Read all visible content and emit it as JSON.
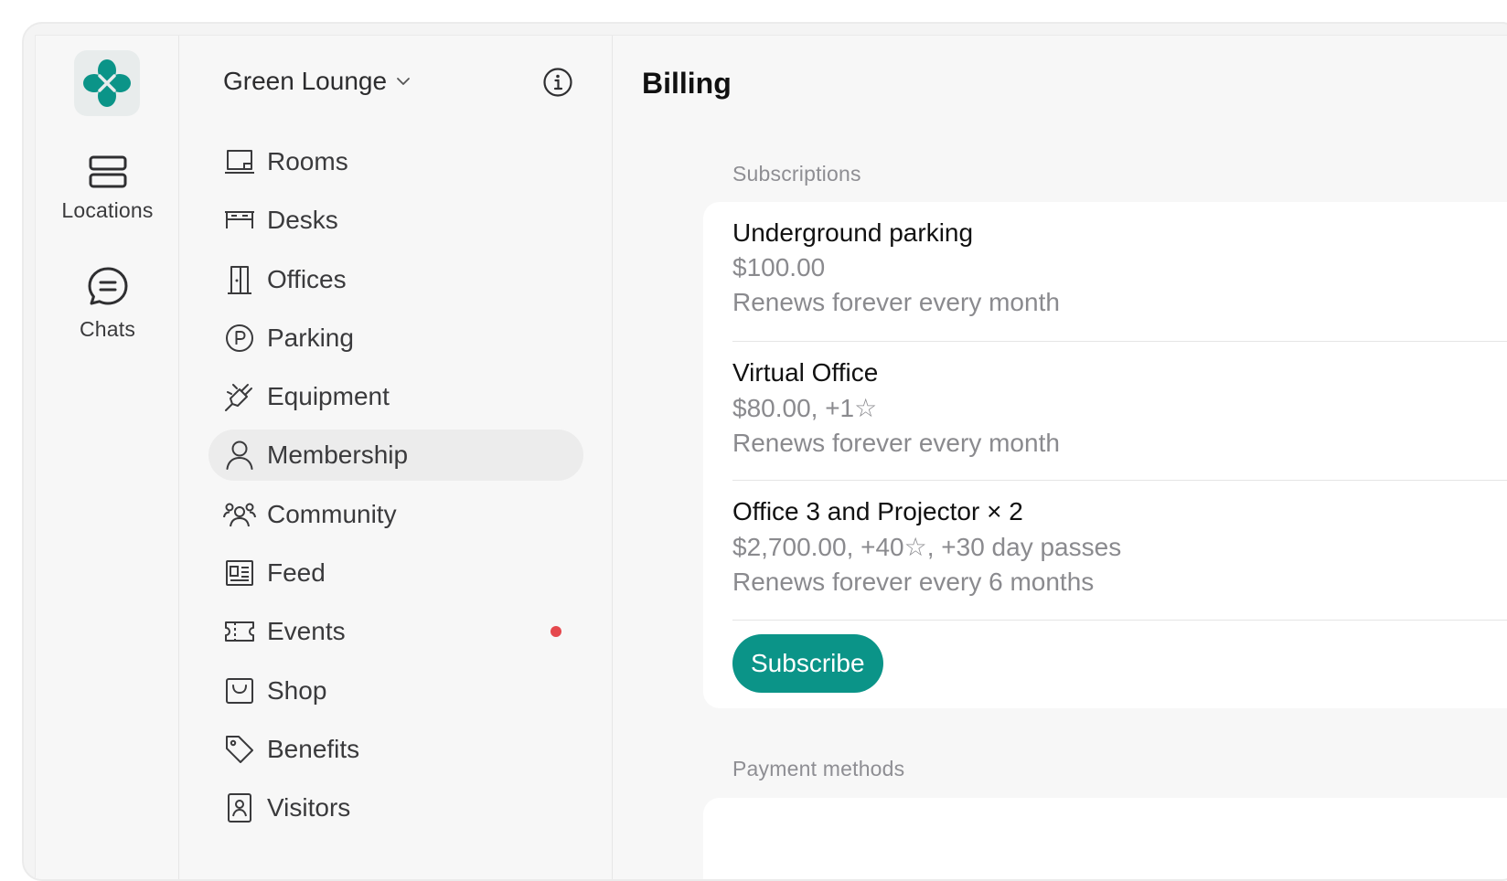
{
  "rail": {
    "items": [
      {
        "label": "Locations",
        "icon": "locations-icon"
      },
      {
        "label": "Chats",
        "icon": "chat-bubble-icon"
      }
    ]
  },
  "nav": {
    "location_name": "Green Lounge",
    "items": [
      {
        "label": "Rooms",
        "icon": "room-icon"
      },
      {
        "label": "Desks",
        "icon": "desk-icon"
      },
      {
        "label": "Offices",
        "icon": "door-icon"
      },
      {
        "label": "Parking",
        "icon": "parking-icon"
      },
      {
        "label": "Equipment",
        "icon": "plug-icon"
      },
      {
        "label": "Membership",
        "icon": "person-icon",
        "active": true
      },
      {
        "label": "Community",
        "icon": "group-icon"
      },
      {
        "label": "Feed",
        "icon": "newspaper-icon"
      },
      {
        "label": "Events",
        "icon": "ticket-icon",
        "badge_color": "#e5484d"
      },
      {
        "label": "Shop",
        "icon": "shop-icon"
      },
      {
        "label": "Benefits",
        "icon": "tag-icon"
      },
      {
        "label": "Visitors",
        "icon": "badge-icon"
      }
    ]
  },
  "main": {
    "title": "Billing",
    "subscriptions_label": "Subscriptions",
    "subscriptions": [
      {
        "name": "Underground parking",
        "price": "$100.00",
        "renewal": "Renews forever every month"
      },
      {
        "name": "Virtual Office",
        "price": "$80.00, +1☆",
        "renewal": "Renews forever every month"
      },
      {
        "name": "Office 3 and Projector × 2",
        "price": "$2,700.00, +40☆, +30 day passes",
        "renewal": "Renews forever every 6 months"
      }
    ],
    "subscribe_label": "Subscribe",
    "payment_methods_label": "Payment methods"
  },
  "colors": {
    "accent": "#0b9488",
    "badge": "#e5484d"
  }
}
